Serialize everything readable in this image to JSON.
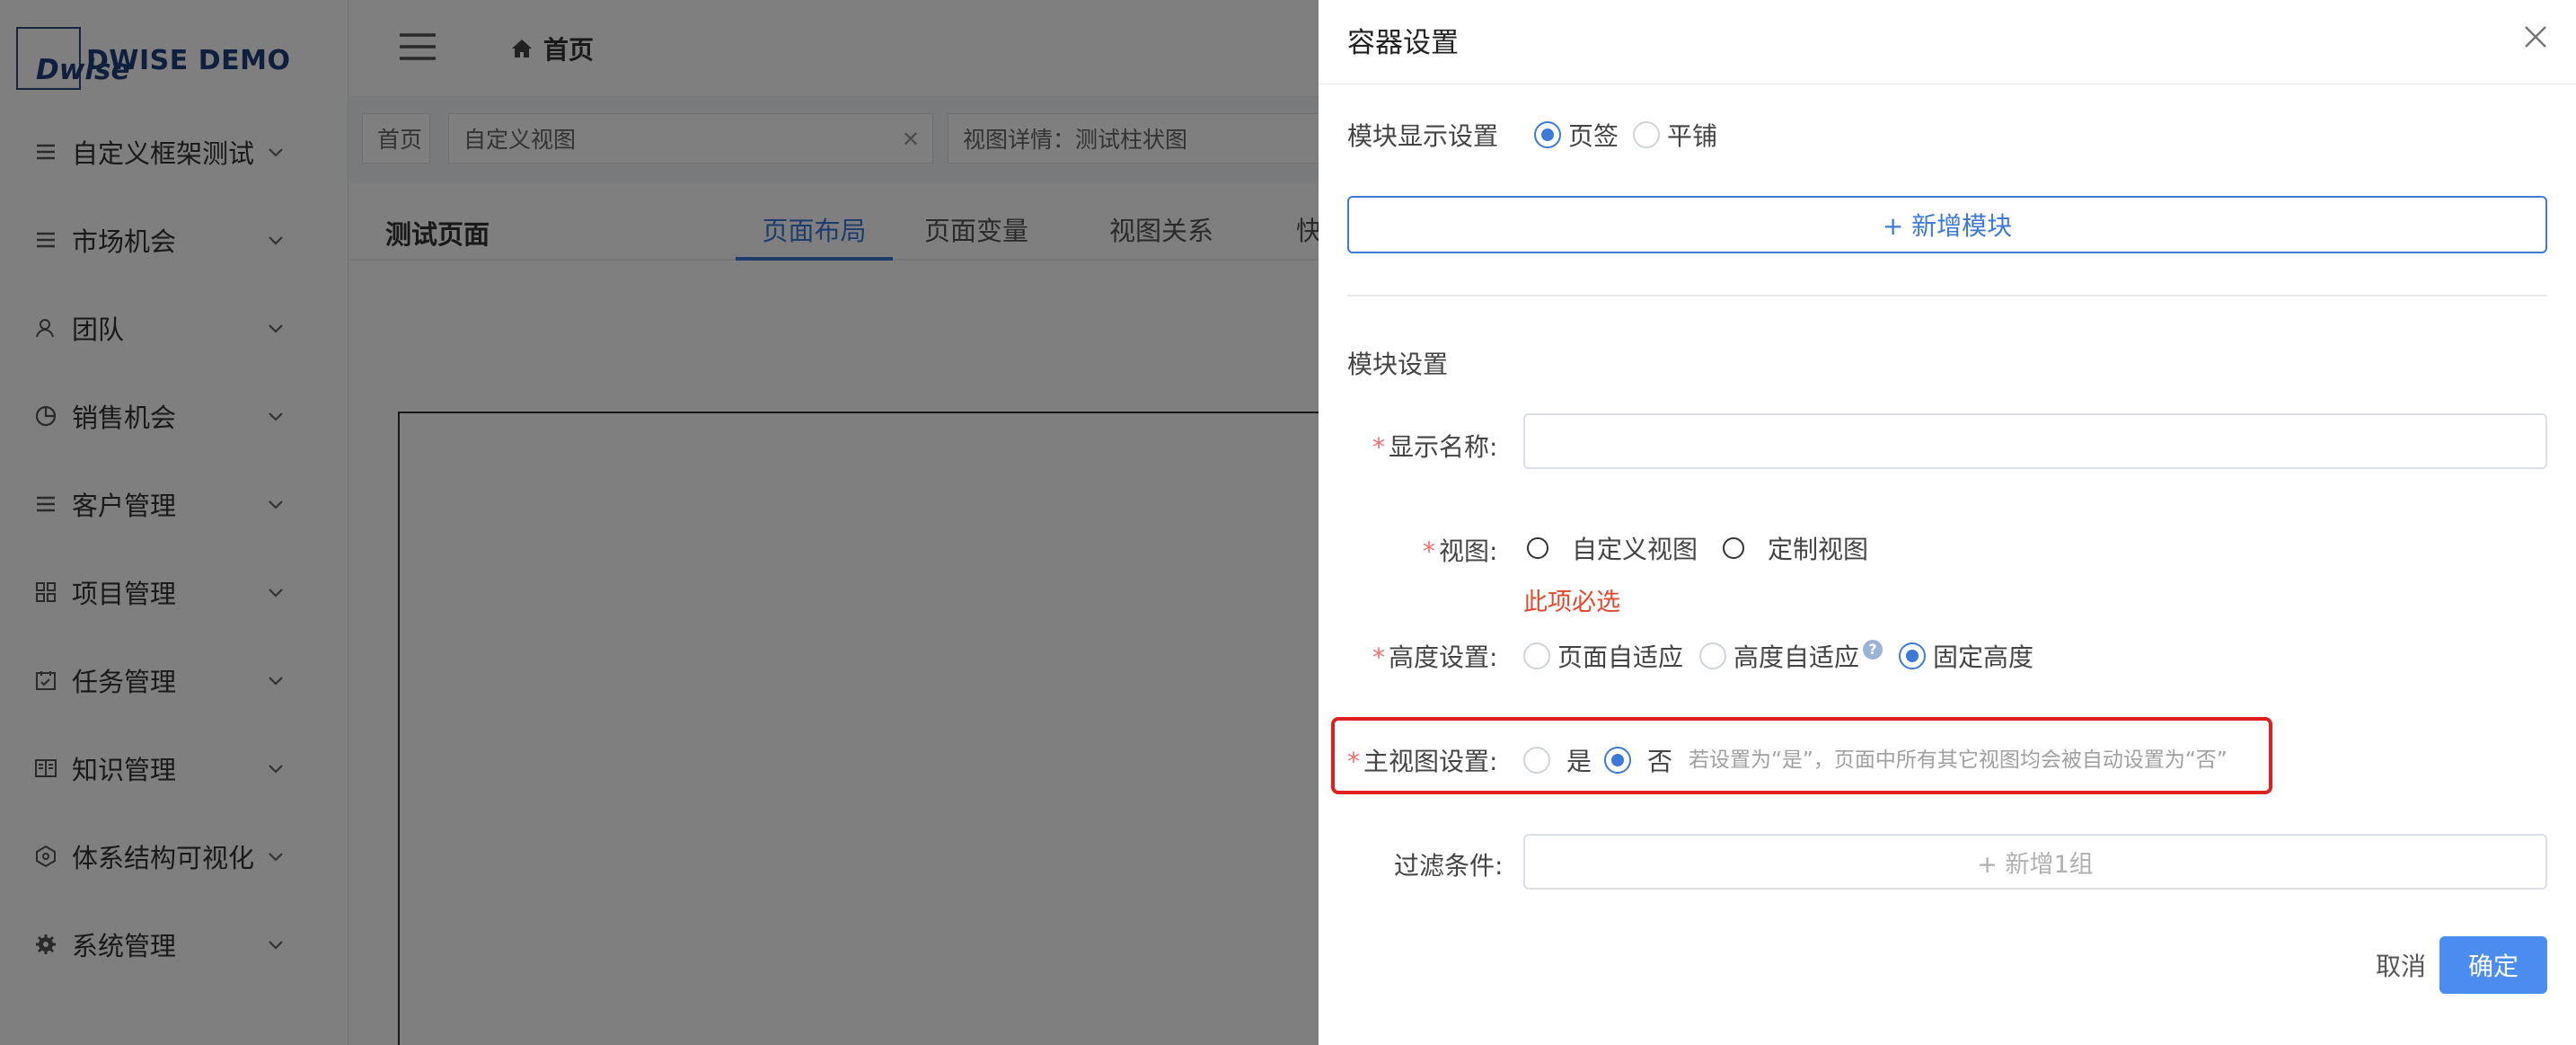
{
  "app": {
    "logo_mark": "Dwise",
    "logo_text": "DWISE DEMO"
  },
  "sidebar": {
    "items": [
      {
        "label": "自定义框架测试",
        "icon": "list-icon"
      },
      {
        "label": "市场机会",
        "icon": "list-icon"
      },
      {
        "label": "团队",
        "icon": "user-icon"
      },
      {
        "label": "销售机会",
        "icon": "pie-icon"
      },
      {
        "label": "客户管理",
        "icon": "list-icon"
      },
      {
        "label": "项目管理",
        "icon": "grid-icon"
      },
      {
        "label": "任务管理",
        "icon": "task-icon"
      },
      {
        "label": "知识管理",
        "icon": "book-icon"
      },
      {
        "label": "体系结构可视化",
        "icon": "network-icon"
      },
      {
        "label": "系统管理",
        "icon": "gear-icon"
      }
    ]
  },
  "header": {
    "home_label": "首页"
  },
  "tags": [
    {
      "label": "首页"
    },
    {
      "label": "自定义视图",
      "closable": true
    },
    {
      "label": "视图详情：测试柱状图"
    }
  ],
  "page": {
    "title": "测试页面",
    "tabs": [
      "页面布局",
      "页面变量",
      "视图关系",
      "快"
    ],
    "active_tab": "页面布局"
  },
  "drawer": {
    "title": "容器设置",
    "module_display_label": "模块显示设置",
    "module_display_options": [
      "页签",
      "平铺"
    ],
    "module_display_selected": "页签",
    "add_module_label": "+ 新增模块",
    "module_settings_label": "模块设置",
    "display_name_label": "显示名称:",
    "display_name_value": "",
    "view_label": "视图:",
    "view_options": [
      "自定义视图",
      "定制视图"
    ],
    "view_error": "此项必选",
    "height_label": "高度设置:",
    "height_options": [
      "页面自适应",
      "高度自适应",
      "固定高度"
    ],
    "height_selected": "固定高度",
    "main_view_label": "主视图设置:",
    "main_view_options": [
      "是",
      "否"
    ],
    "main_view_selected": "否",
    "main_view_hint": "若设置为“是”，页面中所有其它视图均会被自动设置为“否”",
    "filter_label": "过滤条件:",
    "filter_add_label": "+ 新增1组",
    "required_mark": "*",
    "cancel_label": "取消",
    "ok_label": "确定"
  },
  "colors": {
    "accent": "#3d7ad8",
    "primary_button": "#4a8cf0",
    "error": "#e5482d",
    "highlight": "#e02020"
  }
}
